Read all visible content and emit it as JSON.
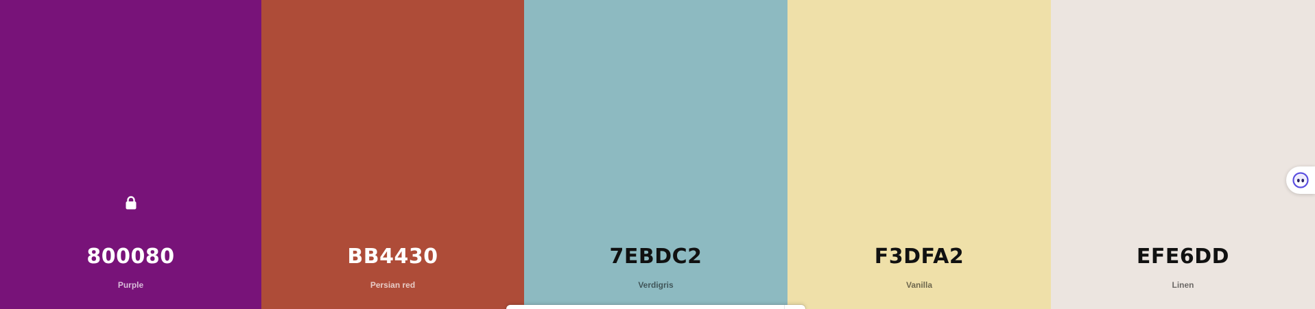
{
  "palette": {
    "colors": [
      {
        "hex": "800080",
        "name": "Purple",
        "bg": "#781379",
        "text_tone": "light",
        "locked": true
      },
      {
        "hex": "BB4430",
        "name": "Persian red",
        "bg": "#AE4C38",
        "text_tone": "light",
        "locked": false
      },
      {
        "hex": "7EBDC2",
        "name": "Verdigris",
        "bg": "#8DBAC1",
        "text_tone": "dark",
        "locked": false
      },
      {
        "hex": "F3DFA2",
        "name": "Vanilla",
        "bg": "#EFE0A9",
        "text_tone": "dark",
        "locked": false
      },
      {
        "hex": "EFE6DD",
        "name": "Linen",
        "bg": "#ECE5E0",
        "text_tone": "dark",
        "locked": false
      }
    ]
  },
  "icons": {
    "lock": "lock-icon",
    "assistant": "assistant-face-icon"
  },
  "accent_colors": {
    "assistant": "#5B4FE0"
  }
}
